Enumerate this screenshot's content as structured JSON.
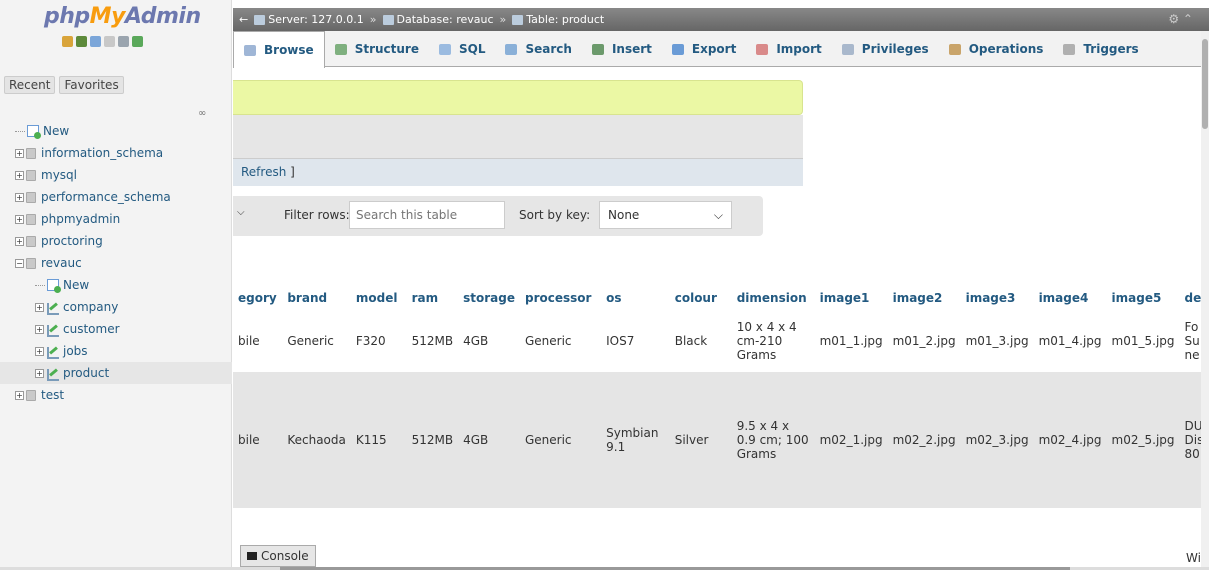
{
  "logo": {
    "part1": "php",
    "part2": "My",
    "part3": "Admin"
  },
  "sidebar": {
    "tabs": [
      "Recent",
      "Favorites"
    ],
    "tree": [
      {
        "label": "New",
        "kind": "new",
        "level": 0
      },
      {
        "label": "information_schema",
        "kind": "db",
        "level": 0
      },
      {
        "label": "mysql",
        "kind": "db",
        "level": 0
      },
      {
        "label": "performance_schema",
        "kind": "db",
        "level": 0
      },
      {
        "label": "phpmyadmin",
        "kind": "db",
        "level": 0
      },
      {
        "label": "proctoring",
        "kind": "db",
        "level": 0
      },
      {
        "label": "revauc",
        "kind": "db-open",
        "level": 0
      },
      {
        "label": "New",
        "kind": "new",
        "level": 1
      },
      {
        "label": "company",
        "kind": "table",
        "level": 1
      },
      {
        "label": "customer",
        "kind": "table",
        "level": 1
      },
      {
        "label": "jobs",
        "kind": "table",
        "level": 1
      },
      {
        "label": "product",
        "kind": "table",
        "level": 1,
        "selected": true
      },
      {
        "label": "test",
        "kind": "db",
        "level": 0
      }
    ]
  },
  "breadcrumb": {
    "server": "Server: 127.0.0.1",
    "database": "Database: revauc",
    "table": "Table: product",
    "separator": "»"
  },
  "tabs": [
    {
      "label": "Browse",
      "icon": "browse-icon",
      "color": "#9fb6d6",
      "active": true
    },
    {
      "label": "Structure",
      "icon": "structure-icon",
      "color": "#7fb07f"
    },
    {
      "label": "SQL",
      "icon": "sql-icon",
      "color": "#9bbbe0"
    },
    {
      "label": "Search",
      "icon": "search-icon",
      "color": "#8ab0d8"
    },
    {
      "label": "Insert",
      "icon": "insert-icon",
      "color": "#6c9a6c"
    },
    {
      "label": "Export",
      "icon": "export-icon",
      "color": "#6a9bd6"
    },
    {
      "label": "Import",
      "icon": "import-icon",
      "color": "#d98a8a"
    },
    {
      "label": "Privileges",
      "icon": "privileges-icon",
      "color": "#a9b8cc"
    },
    {
      "label": "Operations",
      "icon": "operations-icon",
      "color": "#c9a46a"
    },
    {
      "label": "Triggers",
      "icon": "triggers-icon",
      "color": "#b0b0b0"
    }
  ],
  "refresh": {
    "label": "Refresh",
    "bracket": "]"
  },
  "filter": {
    "label": "Filter rows:",
    "placeholder": "Search this table"
  },
  "sort": {
    "label": "Sort by key:",
    "value": "None"
  },
  "table": {
    "columns": [
      "egory",
      "brand",
      "model",
      "ram",
      "storage",
      "processor",
      "os",
      "colour",
      "dimension",
      "image1",
      "image2",
      "image3",
      "image4",
      "image5",
      "de"
    ],
    "rows": [
      [
        "bile",
        "Generic",
        "F320",
        "512MB",
        "4GB",
        "Generic",
        "IOS7",
        "Black",
        "10 x 4 x 4 cm-210 Grams",
        "m01_1.jpg",
        "m01_2.jpg",
        "m01_3.jpg",
        "m01_4.jpg",
        "m01_5.jpg",
        "Fo Su ne"
      ],
      [
        "bile",
        "Kechaoda",
        "K115",
        "512MB",
        "4GB",
        "Generic",
        "Symbian 9.1",
        "Silver",
        "9.5 x 4 x 0.9 cm; 100 Grams",
        "m02_1.jpg",
        "m02_2.jpg",
        "m02_3.jpg",
        "m02_4.jpg",
        "m02_5.jpg",
        "DU Dis 80"
      ]
    ]
  },
  "trailing_text": "Wi",
  "console": {
    "label": "Console"
  }
}
